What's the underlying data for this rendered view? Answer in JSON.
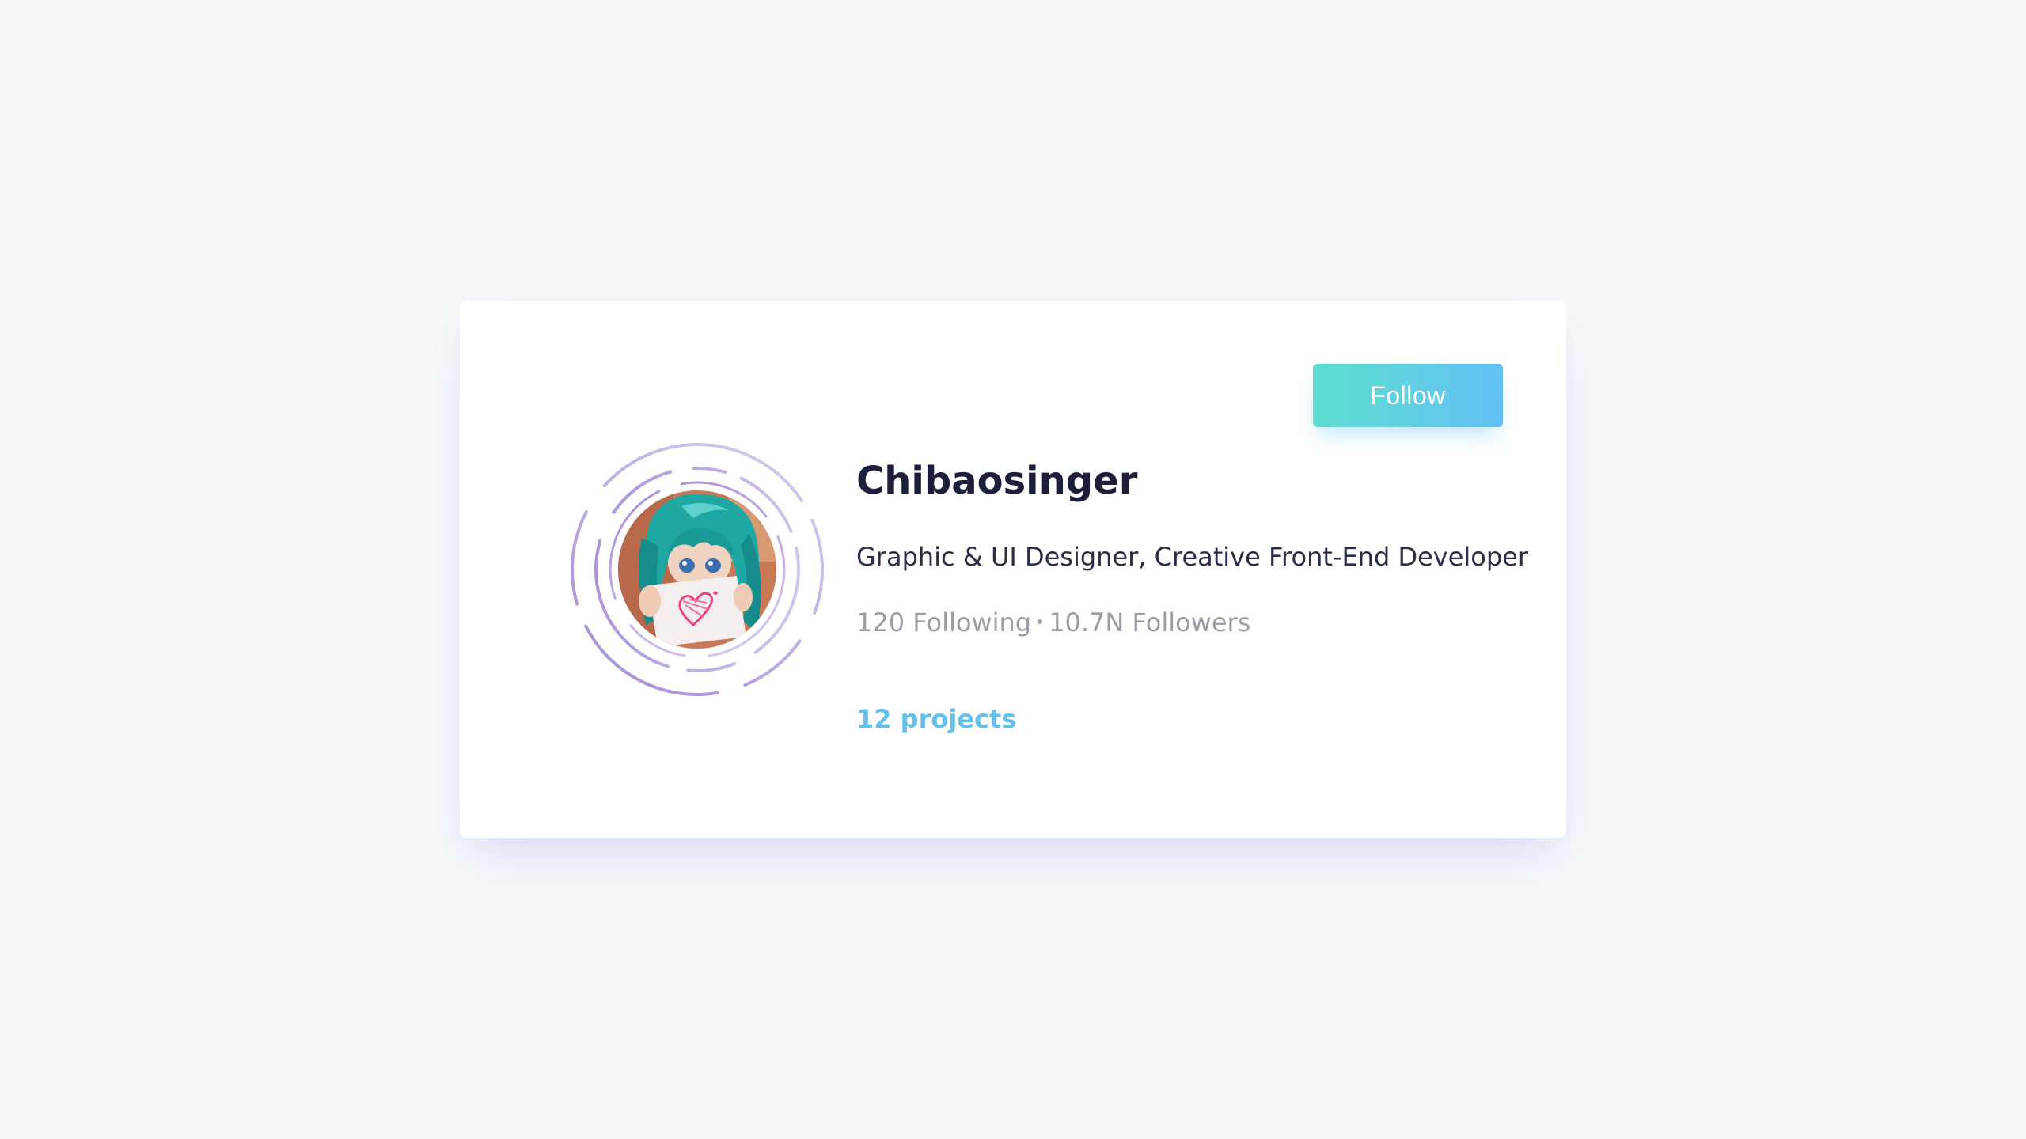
{
  "profile": {
    "name": "Chibaosinger",
    "role": "Graphic & UI Designer, Creative Front-End Developer",
    "following": "120 Following",
    "followers": "10.7N Followers",
    "projects": "12 projects"
  },
  "actions": {
    "follow_label": "Follow"
  },
  "avatar": {
    "icon": "avatar-photo"
  },
  "colors": {
    "background": "#f6f8fb",
    "card": "#ffffff",
    "follow_gradient_start": "#5edfd0",
    "follow_gradient_end": "#62c0f4",
    "name": "#1c1f3a",
    "stats": "#9a9ca8",
    "projects": "#63c0ec",
    "rings": "#b9a8e0"
  }
}
